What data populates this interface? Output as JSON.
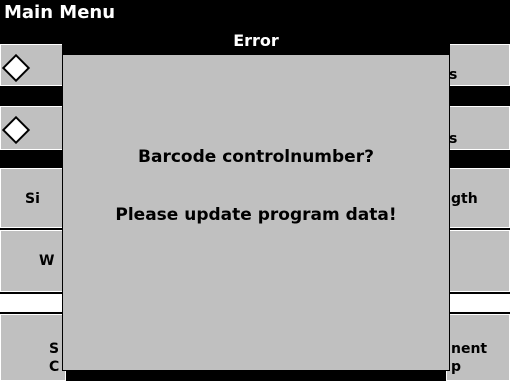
{
  "header": {
    "title": "Main Menu"
  },
  "menu_buttons": {
    "row1_left_icon": "diamond-icon",
    "row1_right_label": "s",
    "row2_left_icon": "diamond-icon",
    "row2_right_label": "s",
    "row3_left_label": "Si",
    "row3_right_label": "gth",
    "row4_left_label": "W",
    "row5_left_label_line1": "S",
    "row5_left_label_line2": "C",
    "row5_right_label_line1": "nent",
    "row5_right_label_line2": "p"
  },
  "dialog": {
    "title": "Error",
    "line1": "Barcode controlnumber?",
    "line2": "Please update program data!"
  },
  "colors": {
    "background": "#000000",
    "button_face": "#c0c0c0",
    "dialog_face": "#c0c0c0",
    "title_bar": "#000000",
    "text": "#000000",
    "title_text": "#ffffff"
  }
}
